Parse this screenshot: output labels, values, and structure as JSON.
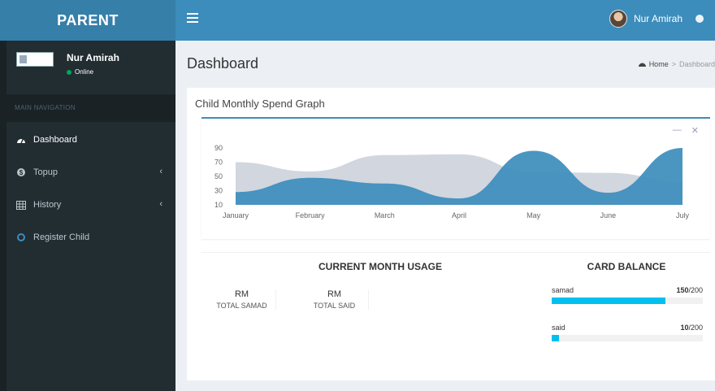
{
  "brand": {
    "logo": "PARENT"
  },
  "navbar": {
    "user_name": "Nur Amirah"
  },
  "sidebar": {
    "user_name": "Nur Amirah",
    "status": "Online",
    "nav_header": "MAIN NAVIGATION",
    "items": [
      {
        "label": "Dashboard",
        "icon": "dashboard-icon"
      },
      {
        "label": "Topup",
        "icon": "money-icon"
      },
      {
        "label": "History",
        "icon": "table-icon"
      },
      {
        "label": "Register Child",
        "icon": "circle-icon"
      }
    ]
  },
  "content": {
    "title": "Dashboard",
    "breadcrumb": {
      "home": "Home",
      "current": "Dashboard"
    }
  },
  "graph": {
    "title": "Child Monthly Spend Graph"
  },
  "chart_data": {
    "type": "area",
    "categories": [
      "January",
      "February",
      "March",
      "April",
      "May",
      "June",
      "July"
    ],
    "yticks": [
      90,
      70,
      50,
      30,
      10
    ],
    "ylim": [
      10,
      90
    ],
    "series": [
      {
        "values": [
          70,
          57,
          80,
          81,
          56,
          55,
          42
        ],
        "color": "#d2d6de"
      },
      {
        "values": [
          28,
          48,
          40,
          19,
          86,
          27,
          90
        ],
        "color": "#3c8dbc"
      }
    ]
  },
  "usage": {
    "title": "CURRENT MONTH USAGE",
    "stats": [
      {
        "value": "RM",
        "label": "TOTAL SAMAD"
      },
      {
        "value": "RM",
        "label": "TOTAL SAID"
      }
    ]
  },
  "balance": {
    "title": "CARD BALANCE",
    "cards": [
      {
        "name": "samad",
        "amount": "150",
        "max": "/200",
        "fraction": 0.75
      },
      {
        "name": "said",
        "amount": "10",
        "max": "/200",
        "fraction": 0.05
      }
    ]
  },
  "colors": {
    "header": "#3c8dbc",
    "logo": "#367fa9",
    "sidebar": "#222d32",
    "progress": "#00c0ef"
  }
}
